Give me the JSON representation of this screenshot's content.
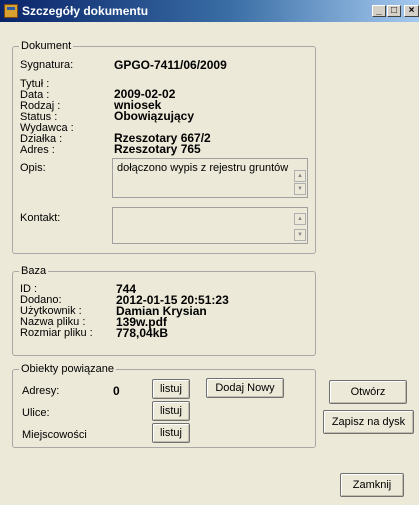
{
  "window": {
    "title": "Szczegóły dokumentu",
    "minimize_glyph": "_",
    "maximize_glyph": "□",
    "close_glyph": "×"
  },
  "dokument": {
    "legend": "Dokument",
    "sygnatura_label": "Sygnatura:",
    "sygnatura_value": "GPGO-7411/06/2009",
    "tytul_label": "Tytuł :",
    "tytul_value": "",
    "data_label": "Data :",
    "data_value": "2009-02-02",
    "rodzaj_label": "Rodzaj :",
    "rodzaj_value": "wniosek",
    "status_label": "Status :",
    "status_value": "Obowiązujący",
    "wydawca_label": "Wydawca :",
    "wydawca_value": "",
    "dzialka_label": "Działka :",
    "dzialka_value": "Rzeszotary 667/2",
    "adres_label": "Adres :",
    "adres_value": "Rzeszotary 765",
    "opis_label": "Opis:",
    "opis_value": "dołączono wypis z rejestru gruntów",
    "kontakt_label": "Kontakt:",
    "kontakt_value": ""
  },
  "baza": {
    "legend": "Baza",
    "id_label": "ID :",
    "id_value": "744",
    "dodano_label": "Dodano:",
    "dodano_value": "2012-01-15 20:51:23",
    "uzytkownik_label": "Użytkownik :",
    "uzytkownik_value": "Damian Krysian",
    "nazwa_label": "Nazwa pliku :",
    "nazwa_value": "139w.pdf",
    "rozmiar_label": "Rozmiar pliku :",
    "rozmiar_value": "778,04kB"
  },
  "obiekty": {
    "legend": "Obiekty powiązane",
    "adresy_label": "Adresy:",
    "adresy_count": "0",
    "ulice_label": "Ulice:",
    "miejscowosci_label": "Miejscowości",
    "listuj_label": "listuj",
    "dodaj_label": "Dodaj Nowy"
  },
  "actions": {
    "otworz": "Otwórz",
    "zapisz": "Zapisz na dysk",
    "zamknij": "Zamknij"
  }
}
